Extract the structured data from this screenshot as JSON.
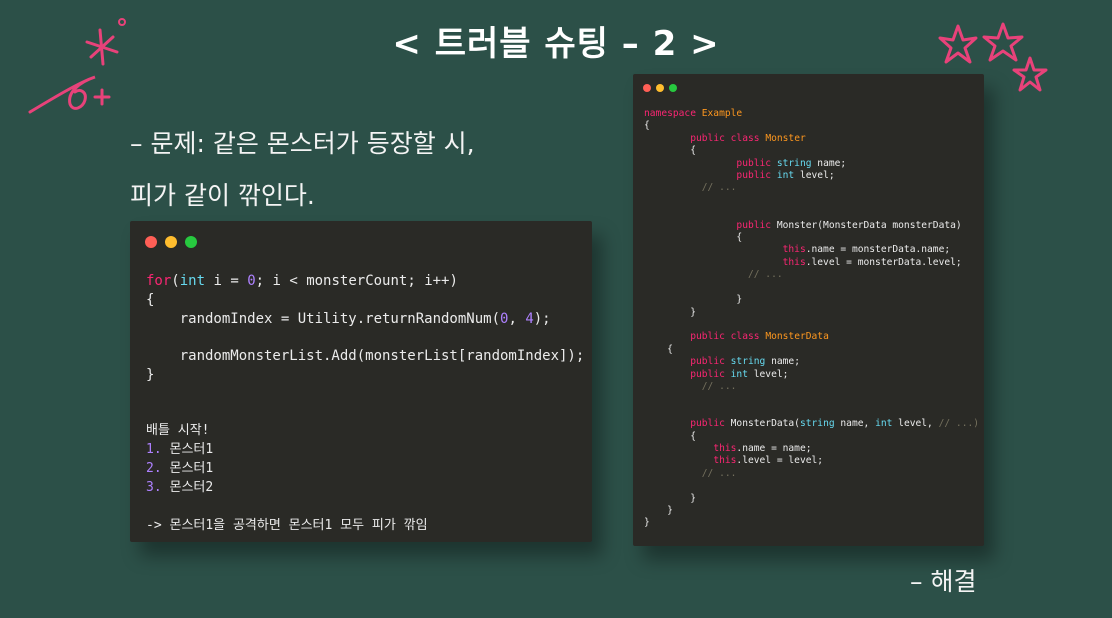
{
  "title": "< 트러블 슈팅 – 2 >",
  "problem": {
    "line1": "– 문제: 같은 몬스터가 등장할 시,",
    "line2": "피가 같이 깎인다."
  },
  "solution_label": "– 해결",
  "colors": {
    "background": "#2c5048",
    "code_bg": "#2a2a26",
    "keyword_pink": "#f92672",
    "keyword_blue": "#66d9ef",
    "number_purple": "#ae81ff",
    "class_orange": "#fd971f",
    "decoration_pink": "#e8427a"
  },
  "left_code": {
    "l1_a": "for",
    "l1_b": "(",
    "l1_c": "int",
    "l1_d": " i = ",
    "l1_e": "0",
    "l1_f": "; i < monsterCount; i++)",
    "l2": "{",
    "l3_a": "    randomIndex = Utility.returnRandomNum(",
    "l3_b": "0",
    "l3_c": ", ",
    "l3_d": "4",
    "l3_e": ");",
    "l4": "    randomMonsterList.Add(monsterList[randomIndex]);",
    "l5": "}"
  },
  "left_output": {
    "header": "배틀 시작!",
    "items": [
      {
        "num": "1.",
        "text": " 몬스터1"
      },
      {
        "num": "2.",
        "text": " 몬스터1"
      },
      {
        "num": "3.",
        "text": " 몬스터2"
      }
    ],
    "note": "-> 몬스터1을 공격하면 몬스터1 모두 피가 깎임"
  },
  "right_code": {
    "ns_kw": "namespace",
    "ns_name": " Example",
    "brace_open": "{",
    "brace_close": "}",
    "public": "public",
    "class": "class",
    "string": "string",
    "int": "int",
    "this": "this",
    "monster_cls": "Monster",
    "monsterdata_cls": "MonsterData",
    "name_field": " name;",
    "level_field": " level;",
    "ellipsis": "// ...",
    "ctor1": " Monster(MonsterData monsterData)",
    "ctor1_body1": ".name = monsterData.name;",
    "ctor1_body2": ".level = monsterData.level;",
    "ctor2": " MonsterData(",
    "ctor2_b": " name, ",
    "ctor2_c": " level, ",
    "ctor2_d": "// ...",
    "ctor2_e": ")",
    "ctor2_body1": ".name = name;",
    "ctor2_body2": ".level = level;"
  }
}
